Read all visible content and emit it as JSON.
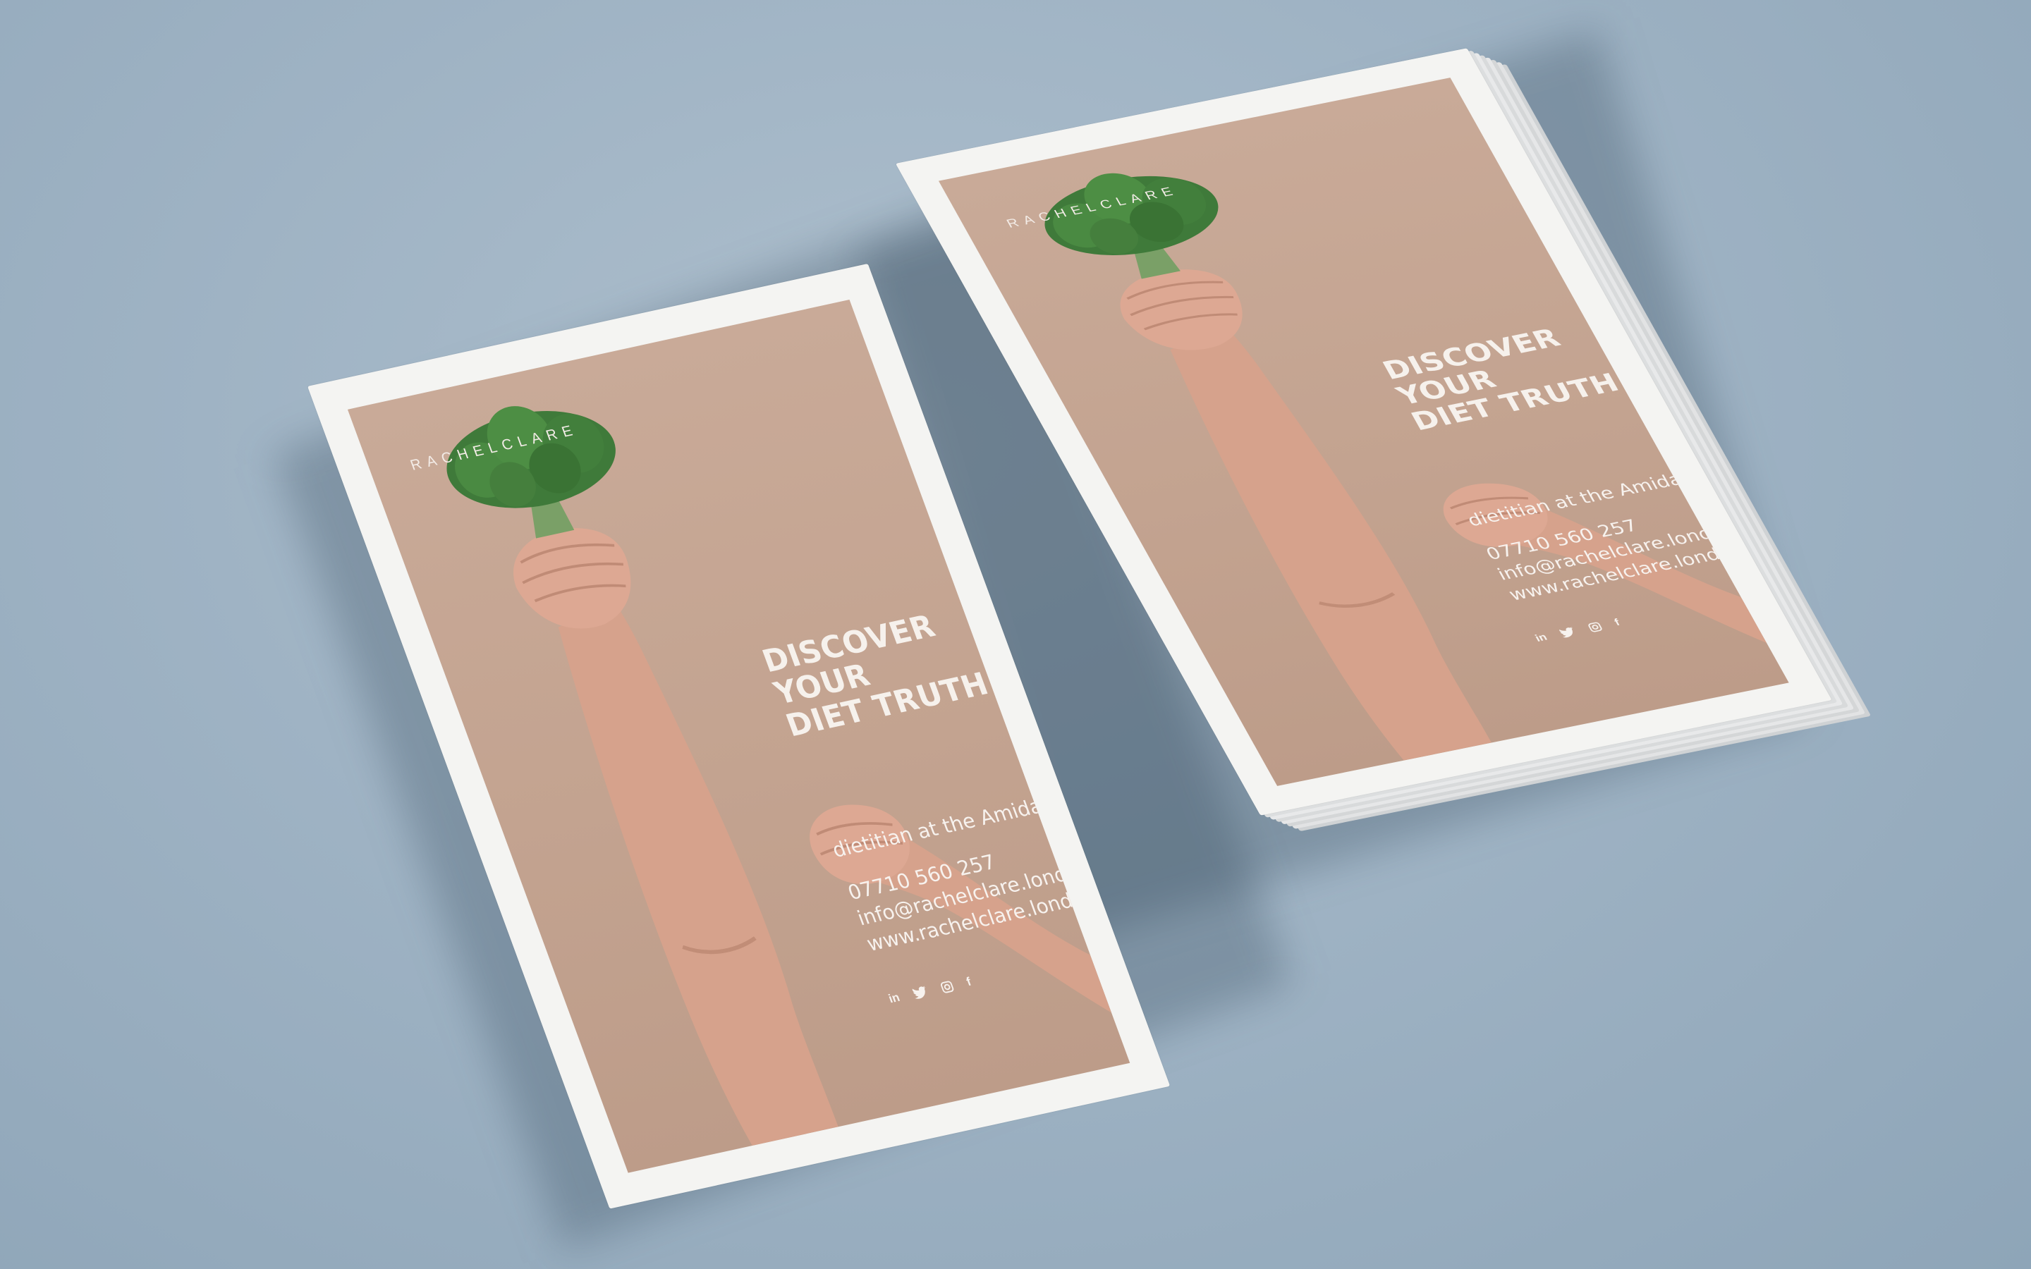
{
  "flyer": {
    "brand": "RACHELCLARE",
    "tagline": "",
    "headline_line1": "DISCOVER YOUR",
    "headline_line2": "DIET TRUTH",
    "subtitle": "dietitian at the Amida Spa",
    "phone": "07710 560 257",
    "email": "info@rachelclare.london",
    "website": "www.rachelclare.london",
    "social_icons": [
      "linkedin-icon",
      "twitter-icon",
      "instagram-icon",
      "facebook-icon"
    ],
    "linkedin_glyph": "in",
    "facebook_glyph": "f"
  },
  "colors": {
    "background": "#9fb3c4",
    "paper": "#f4f4f2",
    "print_background": "#c3a390",
    "text": "#f6f1ec",
    "broccoli": "#3f7a3a",
    "skin": "#d9a590"
  }
}
